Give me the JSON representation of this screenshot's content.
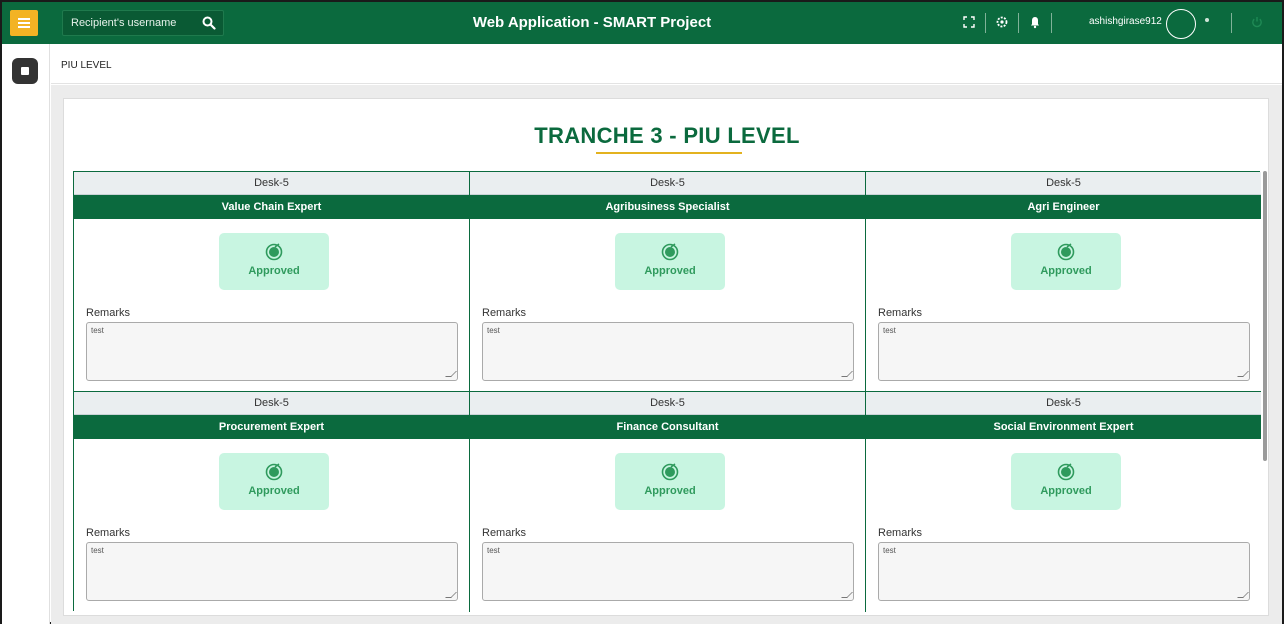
{
  "header": {
    "title": "Web Application - SMART Project",
    "search_placeholder": "Recipient's username",
    "username": "ashishgirase912"
  },
  "breadcrumb": "PIU LEVEL",
  "page": {
    "title": "TRANCHE 3 - PIU LEVEL"
  },
  "cards": [
    {
      "desk": "Desk-5",
      "role": "Value Chain Expert",
      "status": "Approved",
      "remarks_label": "Remarks",
      "remarks": "test"
    },
    {
      "desk": "Desk-5",
      "role": "Agribusiness Specialist",
      "status": "Approved",
      "remarks_label": "Remarks",
      "remarks": "test"
    },
    {
      "desk": "Desk-5",
      "role": "Agri Engineer",
      "status": "Approved",
      "remarks_label": "Remarks",
      "remarks": "test"
    },
    {
      "desk": "Desk-5",
      "role": "Procurement Expert",
      "status": "Approved",
      "remarks_label": "Remarks",
      "remarks": "test"
    },
    {
      "desk": "Desk-5",
      "role": "Finance Consultant",
      "status": "Approved",
      "remarks_label": "Remarks",
      "remarks": "test"
    },
    {
      "desk": "Desk-5",
      "role": "Social Environment Expert",
      "status": "Approved",
      "remarks_label": "Remarks",
      "remarks": "test"
    }
  ],
  "colors": {
    "brand_green": "#0b6a3e",
    "accent_yellow": "#f3b324",
    "approved_bg": "#c8f5e1",
    "approved_text": "#2f9a5d"
  },
  "icons": [
    "hamburger-icon",
    "search-icon",
    "fullscreen-icon",
    "settings-icon",
    "notification-icon",
    "avatar",
    "power-icon",
    "dashboard-icon",
    "check-circle-icon"
  ]
}
